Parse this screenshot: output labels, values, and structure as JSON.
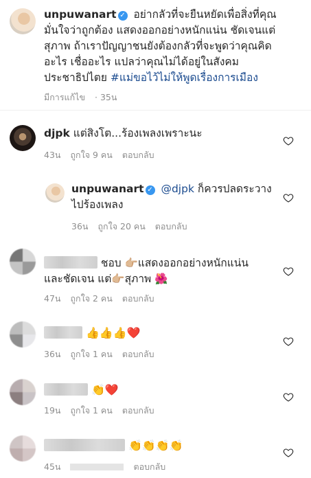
{
  "post": {
    "username": "unpuwanart",
    "caption_lines": [
      "อย่ากลัวที่จะยืนหยัดเพื่อสิ่งที่คุณ",
      "มั่นใจว่าถูกต้อง แสดงออกอย่างหนักแน่น ชัดเจนแต่",
      "สุภาพ  ถ้าเราปัญญาชนยังต้องกลัวที่จะพูดว่าคุณคิด",
      "อะไร เชื่ออะไร แปลว่าคุณไม่ได้อยู่ในสังคม",
      "ประชาธิปไตย"
    ],
    "hashtag": "#แม่ขอไว้ไม่ให้พูดเรื่องการเมือง",
    "edited": "มีการแก้ไข",
    "time": "35น"
  },
  "comments": [
    {
      "username": "djpk",
      "text": "แต่สิงโต...ร้องเพลงเพราะนะ",
      "time": "43น",
      "likes": "ถูกใจ 9 คน",
      "reply": "ตอบกลับ"
    },
    {
      "username": "unpuwanart",
      "mention": "@djpk",
      "text": "ก็ควรปลดระวาง",
      "text2": "ไปร้องเพลง",
      "time": "36น",
      "likes": "ถูกใจ 20 คน",
      "reply": "ตอบกลับ"
    },
    {
      "text": "ชอบ 👉🏼แสดงออกอย่างหนักแน่น",
      "text2": "และชัดเจน แต่👉🏼สุภาพ 🌺",
      "time": "47น",
      "likes": "ถูกใจ 2 คน",
      "reply": "ตอบกลับ"
    },
    {
      "text": "👍👍👍❤️",
      "time": "36น",
      "likes": "ถูกใจ 1 คน",
      "reply": "ตอบกลับ"
    },
    {
      "text": "👏❤️",
      "time": "19น",
      "likes": "ถูกใจ 1 คน",
      "reply": "ตอบกลับ"
    },
    {
      "text": "👏👏👏👏",
      "time": "45น",
      "likes": "",
      "reply": "ตอบกลับ"
    }
  ],
  "icons": {
    "verified": "verified-badge-icon",
    "like": "heart-outline-icon"
  },
  "colors": {
    "link": "#1b4b8f",
    "verified": "#3897f0",
    "meta": "#8e8e8e"
  }
}
